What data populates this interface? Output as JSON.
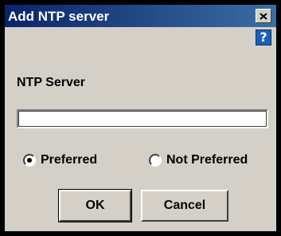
{
  "window": {
    "title": "Add NTP server",
    "close_icon": "close-icon",
    "help_icon": "help-icon",
    "help_glyph": "?"
  },
  "form": {
    "label": "NTP Server",
    "input_value": "",
    "radios": [
      {
        "label": "Preferred",
        "checked": true
      },
      {
        "label": "Not Preferred",
        "checked": false
      }
    ]
  },
  "buttons": {
    "ok_label": "OK",
    "cancel_label": "Cancel"
  },
  "colors": {
    "titlebar_start": "#0a246a",
    "titlebar_end": "#3a6ea5",
    "client_bg": "#d4d0c8",
    "help_bg": "#1c5fb8"
  }
}
